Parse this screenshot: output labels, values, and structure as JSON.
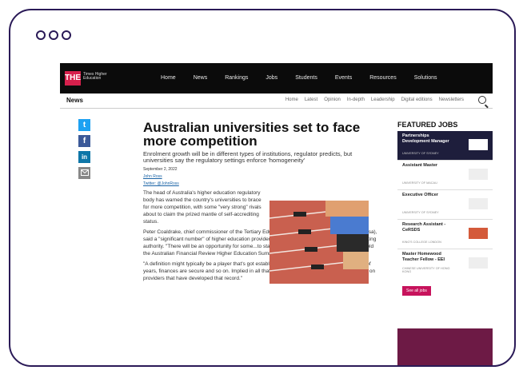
{
  "site": {
    "logo": "THE",
    "logo_text": "Times Higher Education",
    "nav": [
      "Home",
      "News",
      "Rankings",
      "Jobs",
      "Students",
      "Events",
      "Resources",
      "Solutions"
    ]
  },
  "subnav": {
    "section": "News",
    "links": [
      "Home",
      "Latest",
      "Opinion",
      "In-depth",
      "Leadership",
      "Digital editions",
      "Newsletters"
    ]
  },
  "share": [
    "twitter-icon",
    "facebook-icon",
    "linkedin-icon",
    "email-icon"
  ],
  "article": {
    "headline": "Australian universities set to face more competition",
    "standfirst": "Enrolment growth will be in different types of institutions, regulator predicts, but universities say the regulatory settings enforce 'homogeneity'",
    "date": "September 2, 2022",
    "author": "John Ross",
    "twitter": "Twitter: @JohnRoss",
    "para1": "The head of Australia's higher education regulatory body has warned the country's universities to brace for more competition, with some \"very strong\" rivals about to claim the prized mantle of self-accrediting status.",
    "para2": "Peter Coaldrake, chief commissioner of the Tertiary Education Quality and Standards Agency (Teqsa), said a \"significant number\" of higher education providers had the \"maturity\" to warrant self-accrediting authority. \"There will be an opportunity for some...to start moving in that direction fairly soon,\" he told the Australian Financial Review Higher Education Summit in Sydney.",
    "para3": "\"A definition might typically be a player that's got established demand, been around for a number of years, finances are secure and so on. Implied in all that is a level of trust which we would...bestow on providers that have developed that record.\""
  },
  "featured_jobs": {
    "title": "FEATURED JOBS",
    "jobs": [
      {
        "title": "Partnerships Development Manager",
        "employer": "UNIVERSITY OF SYDNEY"
      },
      {
        "title": "Assistant Master",
        "employer": "UNIVERSITY OF MACAU"
      },
      {
        "title": "Executive Officer",
        "employer": "UNIVERSITY OF SYDNEY"
      },
      {
        "title": "Research Assistant - CeRSDS",
        "employer": "KING'S COLLEGE LONDON"
      },
      {
        "title": "Master Homewood Teacher Fellow - EEI",
        "employer": "CHINESE UNIVERSITY OF HONG KONG"
      }
    ],
    "see_all": "See all jobs"
  },
  "colors": {
    "frame": "#2a1a57",
    "brand": "#d6204c",
    "featured_bg": "#1e1e3c",
    "button": "#c7135c"
  }
}
